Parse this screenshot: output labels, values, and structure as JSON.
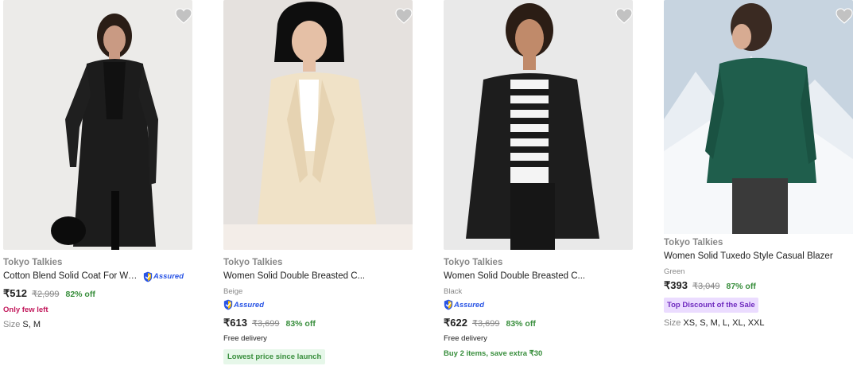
{
  "products": [
    {
      "brand": "Tokyo Talkies",
      "title": "Cotton Blend Solid Coat For Wo...",
      "assured": "Assured",
      "price": "₹512",
      "mrp": "₹2,999",
      "discount": "82% off",
      "stock_note": "Only few left",
      "size_label": "Size",
      "sizes": "S, M",
      "image": "model-black-long-coat-photo"
    },
    {
      "brand": "Tokyo Talkies",
      "title": "Women Solid Double Breasted C...",
      "color": "Beige",
      "assured": "Assured",
      "price": "₹613",
      "mrp": "₹3,699",
      "discount": "83% off",
      "delivery": "Free delivery",
      "offer": "Lowest price since launch",
      "image": "model-beige-blazer-photo"
    },
    {
      "brand": "Tokyo Talkies",
      "title": "Women Solid Double Breasted C...",
      "color": "Black",
      "assured": "Assured",
      "price": "₹622",
      "mrp": "₹3,699",
      "discount": "83% off",
      "delivery": "Free delivery",
      "offer": "Buy 2 items, save extra ₹30",
      "image": "model-black-blazer-photo"
    },
    {
      "brand": "Tokyo Talkies",
      "title": "Women Solid Tuxedo Style Casual Blazer",
      "color": "Green",
      "price": "₹393",
      "mrp": "₹3,049",
      "discount": "87% off",
      "offer": "Top Discount of the Sale",
      "size_label": "Size",
      "sizes": "XS, S, M, L, XL, XXL",
      "image": "model-green-blazer-snow-photo"
    }
  ],
  "colors": {
    "discount": "#388e3c",
    "assured": "#2a55e5",
    "few_left": "#c2185b",
    "offer_purple_bg": "#ebdcff",
    "wishlist": "#c2c2c2"
  }
}
